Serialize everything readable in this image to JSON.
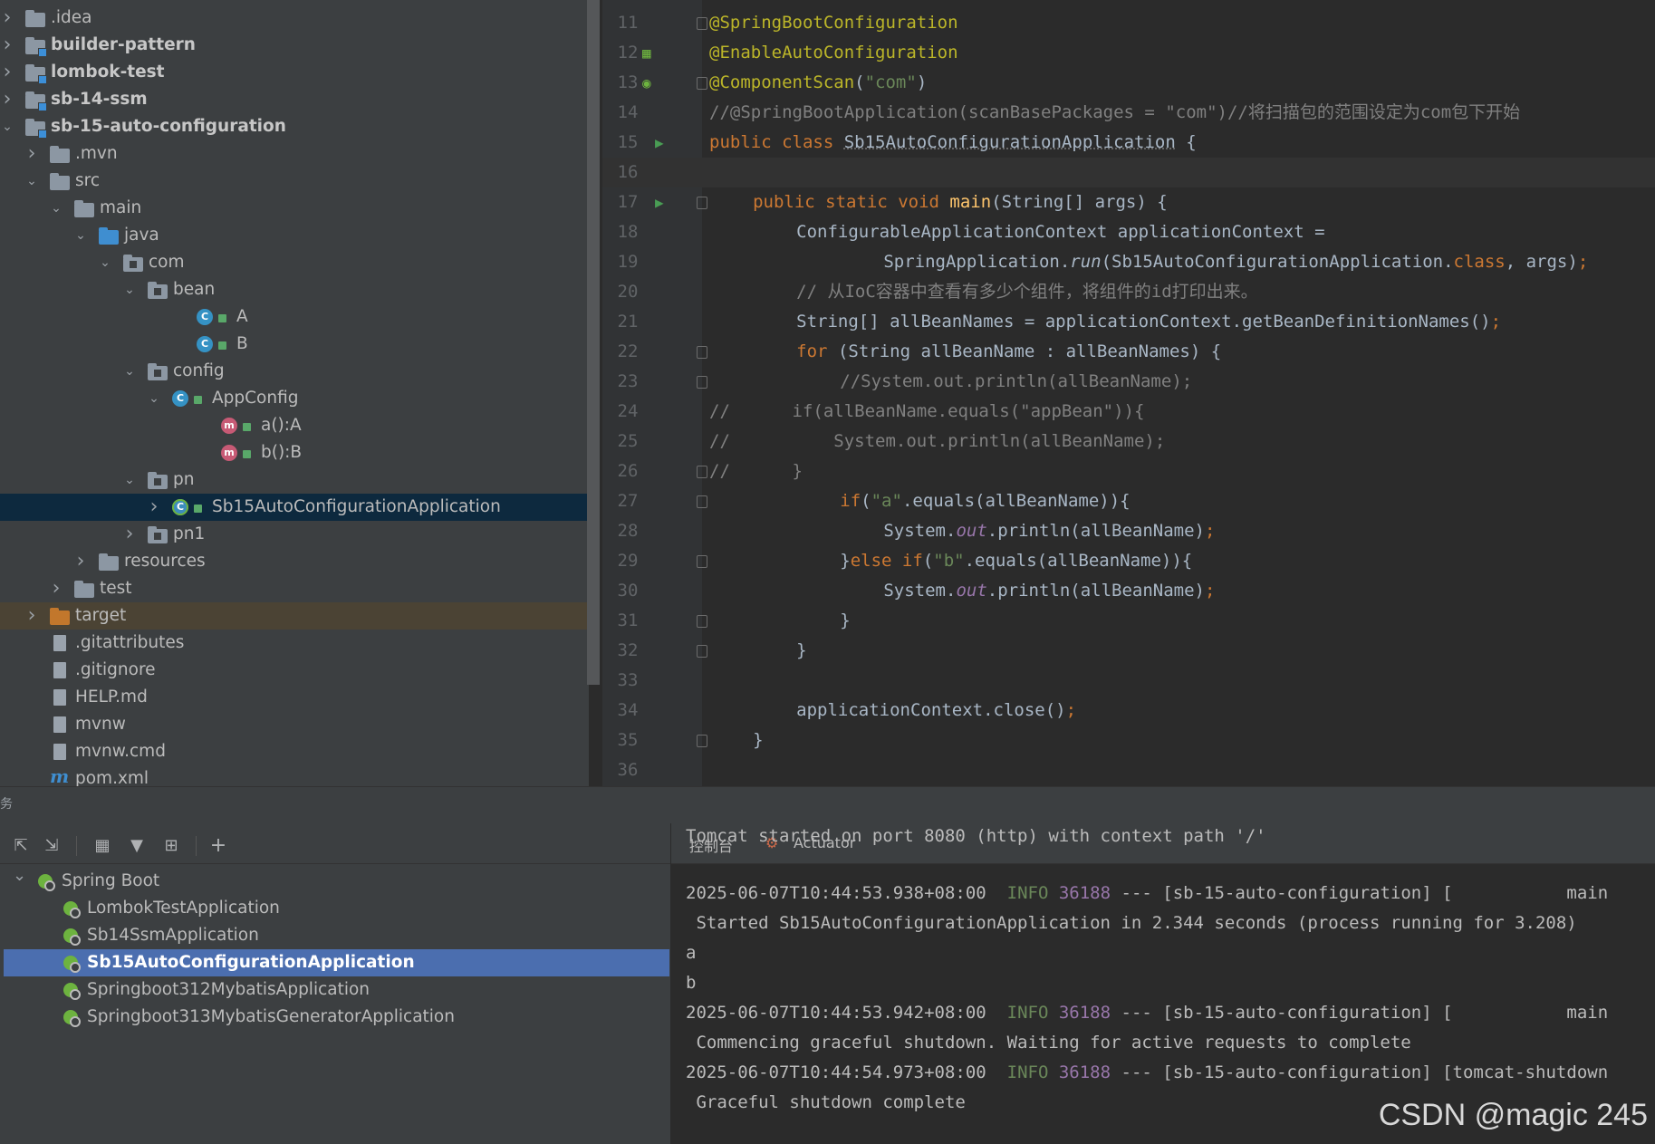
{
  "project_tree": [
    {
      "label": ".idea",
      "kind": "folder",
      "indent": 0,
      "arrow": "right"
    },
    {
      "label": "builder-pattern",
      "kind": "module",
      "indent": 0,
      "arrow": "right",
      "bold": true
    },
    {
      "label": "lombok-test",
      "kind": "module",
      "indent": 0,
      "arrow": "right",
      "bold": true
    },
    {
      "label": "sb-14-ssm",
      "kind": "module",
      "indent": 0,
      "arrow": "right",
      "bold": true
    },
    {
      "label": "sb-15-auto-configuration",
      "kind": "module",
      "indent": 0,
      "arrow": "down",
      "bold": true
    },
    {
      "label": ".mvn",
      "kind": "folder",
      "indent": 1,
      "arrow": "right"
    },
    {
      "label": "src",
      "kind": "folder",
      "indent": 1,
      "arrow": "down"
    },
    {
      "label": "main",
      "kind": "folder",
      "indent": 2,
      "arrow": "down"
    },
    {
      "label": "java",
      "kind": "folder-blue",
      "indent": 3,
      "arrow": "down"
    },
    {
      "label": "com",
      "kind": "package",
      "indent": 4,
      "arrow": "down"
    },
    {
      "label": "bean",
      "kind": "package",
      "indent": 5,
      "arrow": "down"
    },
    {
      "label": "A",
      "kind": "class",
      "indent": 7,
      "arrow": ""
    },
    {
      "label": "B",
      "kind": "class",
      "indent": 7,
      "arrow": ""
    },
    {
      "label": "config",
      "kind": "package",
      "indent": 5,
      "arrow": "down"
    },
    {
      "label": "AppConfig",
      "kind": "class",
      "indent": 6,
      "arrow": "down"
    },
    {
      "label": "a():A",
      "kind": "method",
      "indent": 8,
      "arrow": ""
    },
    {
      "label": "b():B",
      "kind": "method",
      "indent": 8,
      "arrow": ""
    },
    {
      "label": "pn",
      "kind": "package",
      "indent": 5,
      "arrow": "down"
    },
    {
      "label": "Sb15AutoConfigurationApplication",
      "kind": "app-class",
      "indent": 6,
      "arrow": "right",
      "selected": true
    },
    {
      "label": "pn1",
      "kind": "package",
      "indent": 5,
      "arrow": "right"
    },
    {
      "label": "resources",
      "kind": "folder-res",
      "indent": 3,
      "arrow": "right"
    },
    {
      "label": "test",
      "kind": "folder",
      "indent": 2,
      "arrow": "right"
    },
    {
      "label": "target",
      "kind": "folder-orange",
      "indent": 1,
      "arrow": "right",
      "target": true
    },
    {
      "label": ".gitattributes",
      "kind": "file",
      "indent": 1,
      "arrow": ""
    },
    {
      "label": ".gitignore",
      "kind": "file",
      "indent": 1,
      "arrow": ""
    },
    {
      "label": "HELP.md",
      "kind": "file",
      "indent": 1,
      "arrow": ""
    },
    {
      "label": "mvnw",
      "kind": "file",
      "indent": 1,
      "arrow": ""
    },
    {
      "label": "mvnw.cmd",
      "kind": "file",
      "indent": 1,
      "arrow": ""
    },
    {
      "label": "pom.xml",
      "kind": "maven",
      "indent": 1,
      "arrow": ""
    }
  ],
  "editor": {
    "line_numbers": [
      "11",
      "12",
      "13",
      "14",
      "15",
      "16",
      "17",
      "18",
      "19",
      "20",
      "21",
      "22",
      "23",
      "24",
      "25",
      "26",
      "27",
      "28",
      "29",
      "30",
      "31",
      "32",
      "33",
      "34",
      "35",
      "36"
    ],
    "current_line": "16"
  },
  "services": {
    "header_label": "务",
    "toolbar": [
      "expand-all",
      "collapse-all",
      "group",
      "filter",
      "new-service",
      "add"
    ],
    "root": "Spring Boot",
    "apps": [
      "LombokTestApplication",
      "Sb14SsmApplication",
      "Sb15AutoConfigurationApplication",
      "Springboot312MybatisApplication",
      "Springboot313MybatisGeneratorApplication"
    ],
    "selected_app": "Sb15AutoConfigurationApplication"
  },
  "console": {
    "tabs": [
      "控制台",
      "Actuator"
    ],
    "lines": [
      {
        "type": "plain",
        "text": "Tomcat started on port 8080 (http) with context path '/'"
      },
      {
        "type": "log",
        "time": "2025-06-07T10:44:53.938+08:00",
        "level": "INFO",
        "pid": "36188",
        "rest": "--- [sb-15-auto-configuration] [           main"
      },
      {
        "type": "plain",
        "text": " Started Sb15AutoConfigurationApplication in 2.344 seconds (process running for 3.208)"
      },
      {
        "type": "plain",
        "text": "a"
      },
      {
        "type": "plain",
        "text": "b"
      },
      {
        "type": "log",
        "time": "2025-06-07T10:44:53.942+08:00",
        "level": "INFO",
        "pid": "36188",
        "rest": "--- [sb-15-auto-configuration] [           main"
      },
      {
        "type": "plain",
        "text": " Commencing graceful shutdown. Waiting for active requests to complete"
      },
      {
        "type": "log",
        "time": "2025-06-07T10:44:54.973+08:00",
        "level": "INFO",
        "pid": "36188",
        "rest": "--- [sb-15-auto-configuration] [tomcat-shutdown"
      },
      {
        "type": "plain",
        "text": " Graceful shutdown complete"
      }
    ]
  },
  "code_text": {
    "l11": "@SpringBootConfiguration",
    "l12": "@EnableAutoConfiguration",
    "l13a": "@ComponentScan",
    "l13b": "\"com\"",
    "l14": "//@SpringBootApplication(scanBasePackages = \"com\")//将扫描包的范围设定为com包下开始",
    "l15a": "public class ",
    "l15b": "Sb15AutoConfigurationApplication",
    "l17a": "public static void ",
    "l17b": "main",
    "l17c": "(String[] args) {",
    "l18": "ConfigurableApplicationContext applicationContext =",
    "l19a": "SpringApplication.",
    "l19b": "run",
    "l19c": "(Sb15AutoConfigurationApplication.",
    "l19d": "class",
    "l19e": ", args)",
    "l20": "// 从IoC容器中查看有多少个组件，将组件的id打印出来。",
    "l21a": "String[] allBeanNames = applicationContext.getBeanDefinitionNames()",
    "l22a": "for",
    "l22b": " (String allBeanName : allBeanNames) {",
    "l23": "//System.out.println(allBeanName);",
    "l24": "//      if(allBeanName.equals(\"appBean\")){",
    "l25": "//          System.out.println(allBeanName);",
    "l26": "//      }",
    "l27a": "if",
    "l27b": "(",
    "l27c": "\"a\"",
    "l27d": ".equals(allBeanName)){",
    "l28a": "System.",
    "l28b": "out",
    "l28c": ".println(allBeanName)",
    "l29a": "}",
    "l29b": "else if",
    "l29c": "(",
    "l29d": "\"b\"",
    "l29e": ".equals(allBeanName)){",
    "l30a": "System.",
    "l30b": "out",
    "l30c": ".println(allBeanName)",
    "l31": "}",
    "l32": "}",
    "l34a": "applicationContext.close()",
    "l35": "}",
    "semicolon": ";",
    "brace_open": " {",
    "paren_close": ")"
  },
  "watermark": "CSDN @magic 245"
}
